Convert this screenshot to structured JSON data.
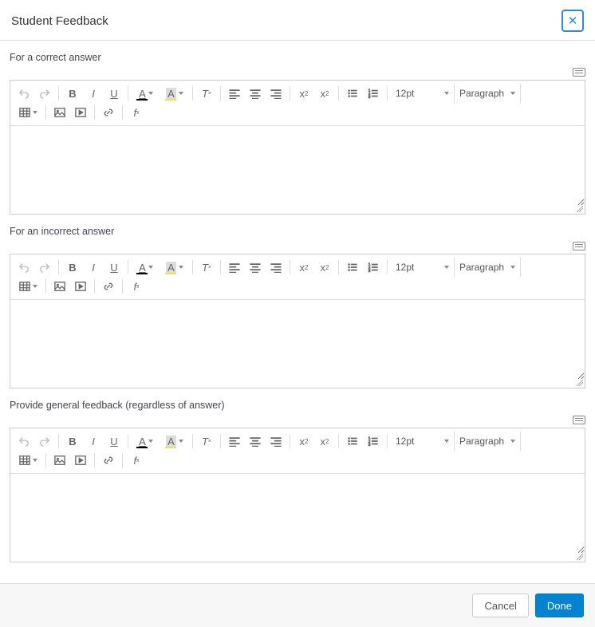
{
  "dialog": {
    "title": "Student Feedback"
  },
  "sections": {
    "correct": {
      "label": "For a correct answer",
      "value": ""
    },
    "incorrect": {
      "label": "For an incorrect answer",
      "value": ""
    },
    "general": {
      "label": "Provide general feedback (regardless of answer)",
      "value": ""
    }
  },
  "editor": {
    "fontsize": "12pt",
    "format": "Paragraph"
  },
  "footer": {
    "cancel": "Cancel",
    "done": "Done"
  }
}
